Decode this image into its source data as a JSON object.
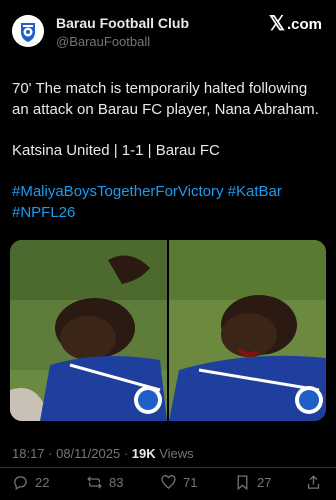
{
  "author": {
    "name": "Barau Football Club",
    "handle": "@BarauFootball"
  },
  "brand": {
    "x_glyph": "𝕏",
    "suffix": ".com"
  },
  "tweet": {
    "line1": "70' The match is temporarily halted following an attack on Barau FC player, Nana Abraham.",
    "line2": "Katsina United | 1-1 | Barau FC",
    "hashtags": "#MaliyaBoysTogetherForVictory #KatBar #NPFL26"
  },
  "meta": {
    "datetime": "18:17 · 08/11/2025 · ",
    "views_count": "19K",
    "views_label": " Views"
  },
  "actions": {
    "replies": "22",
    "reposts": "83",
    "likes": "71",
    "bookmarks": "27"
  },
  "colors": {
    "background": "#000000",
    "text": "#e7e9ea",
    "muted": "#71767b",
    "link": "#1d9bf0",
    "grass": "#5f7d3a",
    "jersey": "#1f3f9e"
  }
}
